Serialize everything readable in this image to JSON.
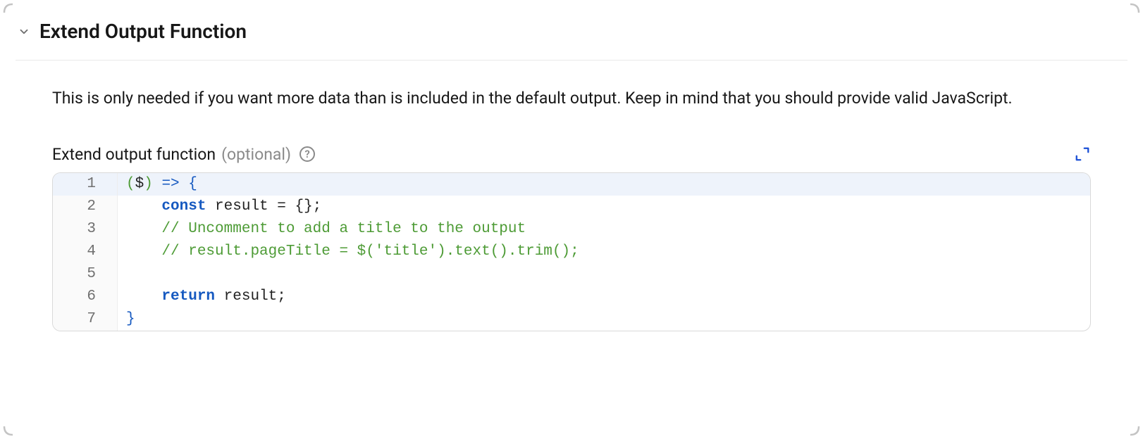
{
  "section": {
    "title": "Extend Output Function",
    "description": "This is only needed if you want more data than is included in the default output. Keep in mind that you should provide valid JavaScript."
  },
  "field": {
    "label": "Extend output function",
    "optional": "(optional)",
    "help": "?"
  },
  "code": {
    "lines": [
      {
        "n": "1",
        "tokens": [
          {
            "cls": "tok-paren",
            "t": "("
          },
          {
            "cls": "tok-ident",
            "t": "$"
          },
          {
            "cls": "tok-paren",
            "t": ") "
          },
          {
            "cls": "tok-arrow",
            "t": "=> "
          },
          {
            "cls": "tok-brace",
            "t": "{"
          }
        ]
      },
      {
        "n": "2",
        "tokens": [
          {
            "cls": "",
            "t": "    "
          },
          {
            "cls": "tok-keyword",
            "t": "const"
          },
          {
            "cls": "",
            "t": " "
          },
          {
            "cls": "tok-ident",
            "t": "result"
          },
          {
            "cls": "tok-op",
            "t": " = {};"
          }
        ]
      },
      {
        "n": "3",
        "tokens": [
          {
            "cls": "",
            "t": "    "
          },
          {
            "cls": "tok-comment",
            "t": "// Uncomment to add a title to the output"
          }
        ]
      },
      {
        "n": "4",
        "tokens": [
          {
            "cls": "",
            "t": "    "
          },
          {
            "cls": "tok-comment",
            "t": "// result.pageTitle = $('title').text().trim();"
          }
        ]
      },
      {
        "n": "5",
        "tokens": [
          {
            "cls": "",
            "t": ""
          }
        ]
      },
      {
        "n": "6",
        "tokens": [
          {
            "cls": "",
            "t": "    "
          },
          {
            "cls": "tok-keyword",
            "t": "return"
          },
          {
            "cls": "",
            "t": " "
          },
          {
            "cls": "tok-ident",
            "t": "result"
          },
          {
            "cls": "tok-op",
            "t": ";"
          }
        ]
      },
      {
        "n": "7",
        "tokens": [
          {
            "cls": "tok-brace",
            "t": "}"
          }
        ]
      }
    ]
  }
}
